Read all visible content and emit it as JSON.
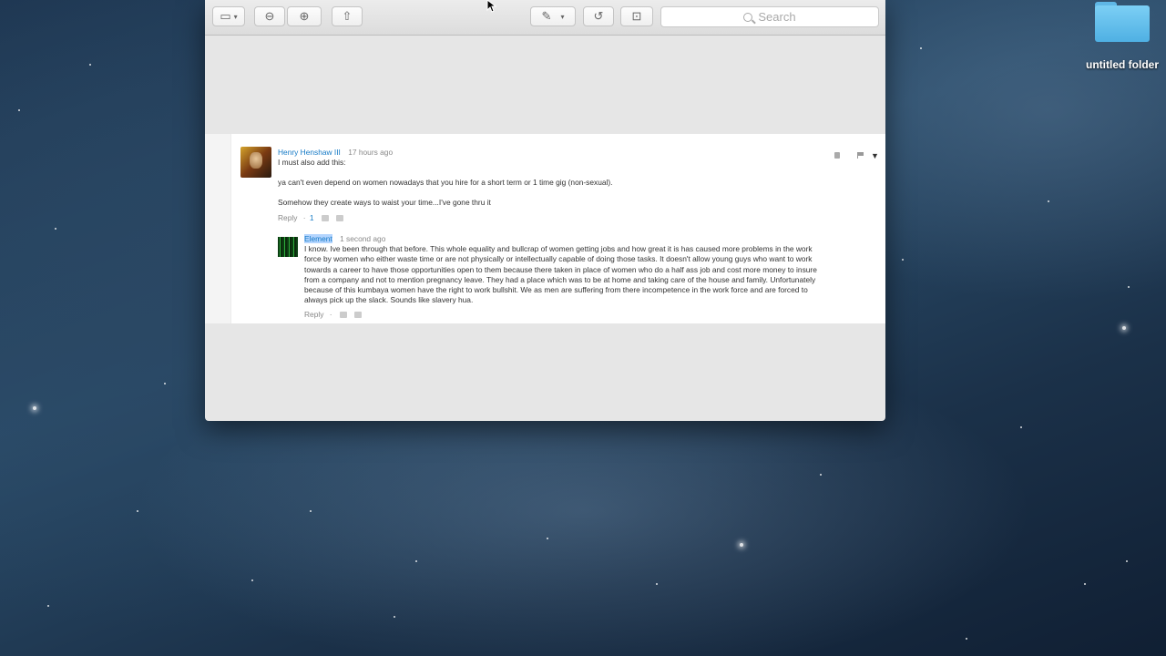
{
  "desktop": {
    "folder_label": "untitled folder"
  },
  "toolbar": {
    "search_placeholder": "Search"
  },
  "comments": {
    "main": {
      "author": "Henry Henshaw III",
      "time": "17 hours ago",
      "line1": "I must also add this:",
      "line2": "ya can't even depend on women nowadays that you hire for a short term or 1 time gig (non-sexual).",
      "line3": "Somehow they create ways to waist your time...I've gone thru it",
      "reply_label": "Reply",
      "separator": "·",
      "likes": "1"
    },
    "reply": {
      "author": "Element",
      "time": "1 second ago",
      "text_lines": [
        "I know. Ive been through that before. This whole equality and bullcrap of women getting jobs and how great it is has caused more problems in the work",
        "force by women who either waste time or are not physically or intellectually capable of doing those tasks. It doesn't allow young guys who want to work",
        "towards a career to have those opportunities open to them because there taken in place of women who do a half ass job and cost more money to insure",
        "from a company and not to mention pregnancy leave. They had a place which was to be at home and taking care of the house and family. Unfortunately",
        "because of this kumbaya women have the right to work bullshit. We as men are suffering from there incompetence in the work force and are forced to",
        "always pick up the slack. Sounds like slavery hua."
      ],
      "reply_label": "Reply",
      "separator": "·"
    }
  }
}
